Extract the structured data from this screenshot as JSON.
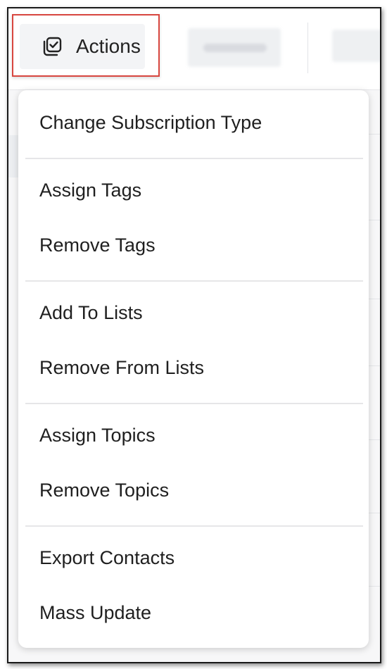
{
  "toolbar": {
    "actions_label": "Actions",
    "actions_icon": "checkbox-stack-icon"
  },
  "menu": {
    "items": [
      {
        "label": "Change Subscription Type"
      },
      {
        "label": "Assign Tags"
      },
      {
        "label": "Remove Tags"
      },
      {
        "label": "Add To Lists"
      },
      {
        "label": "Remove From Lists"
      },
      {
        "label": "Assign Topics"
      },
      {
        "label": "Remove Topics"
      },
      {
        "label": "Export Contacts"
      },
      {
        "label": "Mass Update"
      }
    ]
  },
  "colors": {
    "highlight_border": "#d8463f",
    "text": "#1f1f1f",
    "divider": "#e6e6e8"
  }
}
